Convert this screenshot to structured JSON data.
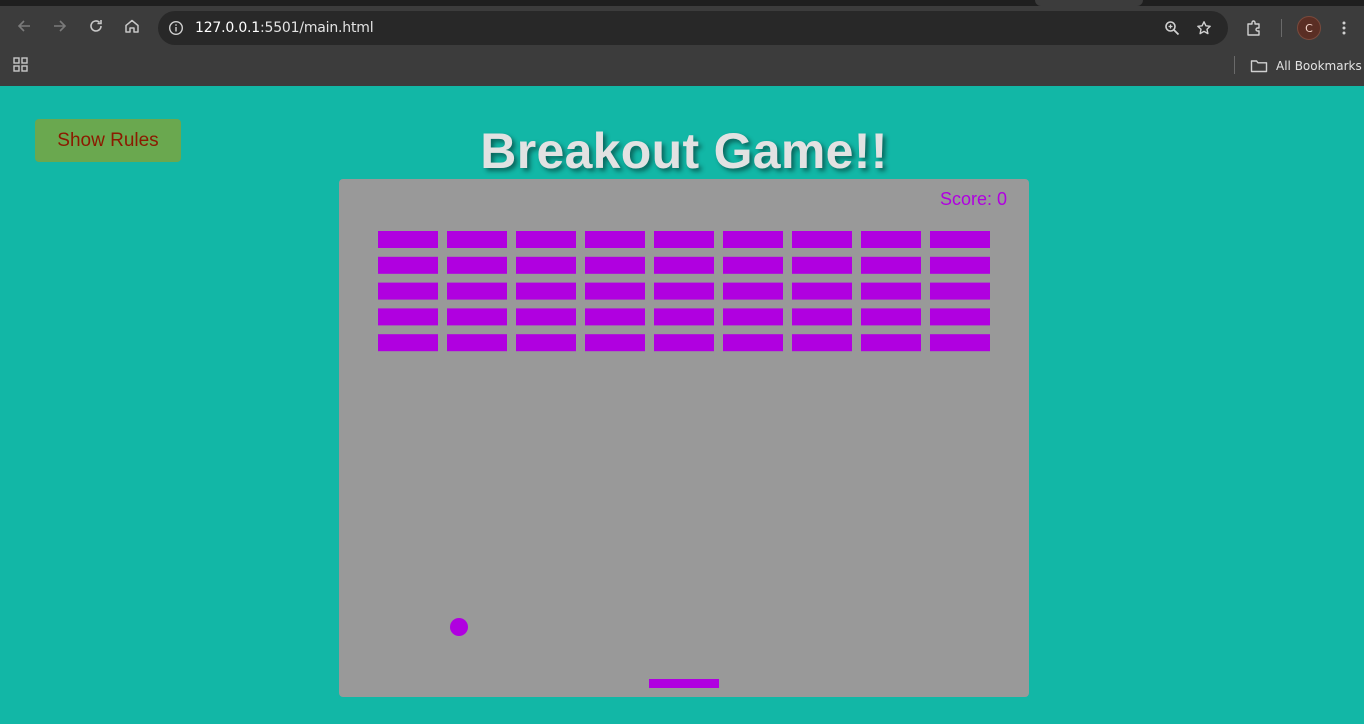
{
  "browser": {
    "url_host": "127.0.0.1",
    "url_rest": ":5501/main.html",
    "profile_initial": "C",
    "bookmarks_label": "All Bookmarks",
    "icons": [
      "back-arrow-icon",
      "forward-arrow-icon",
      "reload-icon",
      "home-icon",
      "site-info-icon",
      "zoom-icon",
      "bookmark-star-icon",
      "extensions-icon",
      "menu-kebab-icon",
      "apps-grid-icon",
      "folder-icon"
    ]
  },
  "page": {
    "title": "Breakout Game!!",
    "rules_button": "Show Rules",
    "score_label": "Score: 0"
  },
  "game": {
    "score": 0,
    "brick_rows": 5,
    "brick_cols": 9,
    "brick_color": "#b000e0",
    "ball_color": "#b000e0",
    "paddle_color": "#b000e0",
    "canvas_color": "#999999",
    "background_color": "#12b7a6",
    "button_color": "#6aa84f",
    "button_text_color": "#8b1a00"
  }
}
